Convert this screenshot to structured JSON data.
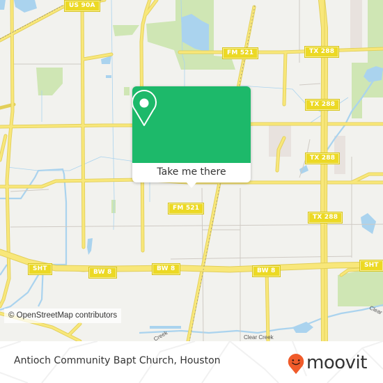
{
  "map": {
    "attribution": "© OpenStreetMap contributors",
    "road_shields": [
      {
        "id": "us-90a",
        "label": "US 90A"
      },
      {
        "id": "fm-521-north",
        "label": "FM 521"
      },
      {
        "id": "tx-288-1",
        "label": "TX 288"
      },
      {
        "id": "tx-288-2",
        "label": "TX 288"
      },
      {
        "id": "tx-288-3",
        "label": "TX 288"
      },
      {
        "id": "fm-521-south",
        "label": "FM 521"
      },
      {
        "id": "tx-288-4",
        "label": "TX 288"
      },
      {
        "id": "sht-west",
        "label": "SHT"
      },
      {
        "id": "bw-8-1",
        "label": "BW 8"
      },
      {
        "id": "bw-8-2",
        "label": "BW 8"
      },
      {
        "id": "bw-8-3",
        "label": "BW 8"
      },
      {
        "id": "sht-east",
        "label": "SHT"
      }
    ],
    "water_labels": {
      "clear_creek_center": "Clear Creek",
      "clear_creek_east": "Clear",
      "creek_west": "Creek"
    },
    "colors": {
      "land": "#f2f2ee",
      "road": "#f8e77a",
      "road_outline": "#e2cf59",
      "water": "#aad3ee",
      "park": "#cfe6b4",
      "popup_green": "#1db96a",
      "moovit_orange": "#f05b2a"
    }
  },
  "popup": {
    "icon": "location-pin-icon",
    "action_label": "Take me there"
  },
  "footer": {
    "place_title": "Antioch Community Bapt Church, Houston",
    "brand": "moovit"
  }
}
